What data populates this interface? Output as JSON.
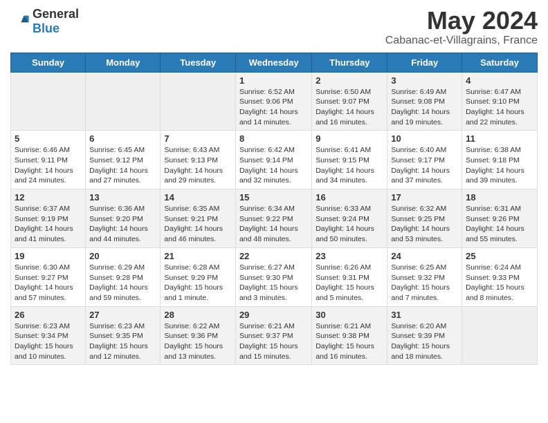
{
  "header": {
    "logo_general": "General",
    "logo_blue": "Blue",
    "month_title": "May 2024",
    "location": "Cabanac-et-Villagrains, France"
  },
  "days_of_week": [
    "Sunday",
    "Monday",
    "Tuesday",
    "Wednesday",
    "Thursday",
    "Friday",
    "Saturday"
  ],
  "weeks": [
    [
      {
        "day": "",
        "info": ""
      },
      {
        "day": "",
        "info": ""
      },
      {
        "day": "",
        "info": ""
      },
      {
        "day": "1",
        "info": "Sunrise: 6:52 AM\nSunset: 9:06 PM\nDaylight: 14 hours and 14 minutes."
      },
      {
        "day": "2",
        "info": "Sunrise: 6:50 AM\nSunset: 9:07 PM\nDaylight: 14 hours and 16 minutes."
      },
      {
        "day": "3",
        "info": "Sunrise: 6:49 AM\nSunset: 9:08 PM\nDaylight: 14 hours and 19 minutes."
      },
      {
        "day": "4",
        "info": "Sunrise: 6:47 AM\nSunset: 9:10 PM\nDaylight: 14 hours and 22 minutes."
      }
    ],
    [
      {
        "day": "5",
        "info": "Sunrise: 6:46 AM\nSunset: 9:11 PM\nDaylight: 14 hours and 24 minutes."
      },
      {
        "day": "6",
        "info": "Sunrise: 6:45 AM\nSunset: 9:12 PM\nDaylight: 14 hours and 27 minutes."
      },
      {
        "day": "7",
        "info": "Sunrise: 6:43 AM\nSunset: 9:13 PM\nDaylight: 14 hours and 29 minutes."
      },
      {
        "day": "8",
        "info": "Sunrise: 6:42 AM\nSunset: 9:14 PM\nDaylight: 14 hours and 32 minutes."
      },
      {
        "day": "9",
        "info": "Sunrise: 6:41 AM\nSunset: 9:15 PM\nDaylight: 14 hours and 34 minutes."
      },
      {
        "day": "10",
        "info": "Sunrise: 6:40 AM\nSunset: 9:17 PM\nDaylight: 14 hours and 37 minutes."
      },
      {
        "day": "11",
        "info": "Sunrise: 6:38 AM\nSunset: 9:18 PM\nDaylight: 14 hours and 39 minutes."
      }
    ],
    [
      {
        "day": "12",
        "info": "Sunrise: 6:37 AM\nSunset: 9:19 PM\nDaylight: 14 hours and 41 minutes."
      },
      {
        "day": "13",
        "info": "Sunrise: 6:36 AM\nSunset: 9:20 PM\nDaylight: 14 hours and 44 minutes."
      },
      {
        "day": "14",
        "info": "Sunrise: 6:35 AM\nSunset: 9:21 PM\nDaylight: 14 hours and 46 minutes."
      },
      {
        "day": "15",
        "info": "Sunrise: 6:34 AM\nSunset: 9:22 PM\nDaylight: 14 hours and 48 minutes."
      },
      {
        "day": "16",
        "info": "Sunrise: 6:33 AM\nSunset: 9:24 PM\nDaylight: 14 hours and 50 minutes."
      },
      {
        "day": "17",
        "info": "Sunrise: 6:32 AM\nSunset: 9:25 PM\nDaylight: 14 hours and 53 minutes."
      },
      {
        "day": "18",
        "info": "Sunrise: 6:31 AM\nSunset: 9:26 PM\nDaylight: 14 hours and 55 minutes."
      }
    ],
    [
      {
        "day": "19",
        "info": "Sunrise: 6:30 AM\nSunset: 9:27 PM\nDaylight: 14 hours and 57 minutes."
      },
      {
        "day": "20",
        "info": "Sunrise: 6:29 AM\nSunset: 9:28 PM\nDaylight: 14 hours and 59 minutes."
      },
      {
        "day": "21",
        "info": "Sunrise: 6:28 AM\nSunset: 9:29 PM\nDaylight: 15 hours and 1 minute."
      },
      {
        "day": "22",
        "info": "Sunrise: 6:27 AM\nSunset: 9:30 PM\nDaylight: 15 hours and 3 minutes."
      },
      {
        "day": "23",
        "info": "Sunrise: 6:26 AM\nSunset: 9:31 PM\nDaylight: 15 hours and 5 minutes."
      },
      {
        "day": "24",
        "info": "Sunrise: 6:25 AM\nSunset: 9:32 PM\nDaylight: 15 hours and 7 minutes."
      },
      {
        "day": "25",
        "info": "Sunrise: 6:24 AM\nSunset: 9:33 PM\nDaylight: 15 hours and 8 minutes."
      }
    ],
    [
      {
        "day": "26",
        "info": "Sunrise: 6:23 AM\nSunset: 9:34 PM\nDaylight: 15 hours and 10 minutes."
      },
      {
        "day": "27",
        "info": "Sunrise: 6:23 AM\nSunset: 9:35 PM\nDaylight: 15 hours and 12 minutes."
      },
      {
        "day": "28",
        "info": "Sunrise: 6:22 AM\nSunset: 9:36 PM\nDaylight: 15 hours and 13 minutes."
      },
      {
        "day": "29",
        "info": "Sunrise: 6:21 AM\nSunset: 9:37 PM\nDaylight: 15 hours and 15 minutes."
      },
      {
        "day": "30",
        "info": "Sunrise: 6:21 AM\nSunset: 9:38 PM\nDaylight: 15 hours and 16 minutes."
      },
      {
        "day": "31",
        "info": "Sunrise: 6:20 AM\nSunset: 9:39 PM\nDaylight: 15 hours and 18 minutes."
      },
      {
        "day": "",
        "info": ""
      }
    ]
  ]
}
